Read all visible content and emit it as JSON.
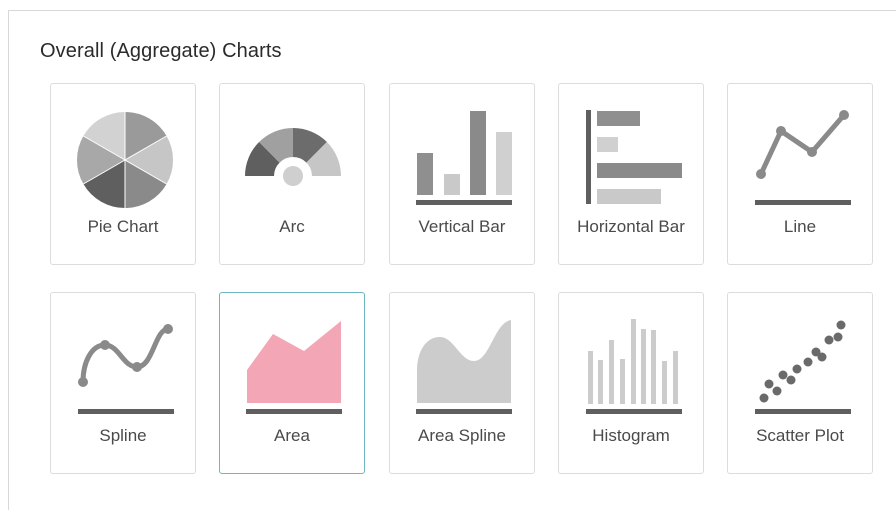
{
  "section": {
    "title": "Overall (Aggregate) Charts"
  },
  "colors": {
    "gray_dark": "#5f5f5f",
    "gray_mid": "#8f8f8f",
    "gray_light": "#c9c9c9",
    "pink": "#f3a6b6",
    "selected_border": "#6fb6c2"
  },
  "tiles": [
    {
      "label": "Pie Chart",
      "icon": "pie-chart-icon"
    },
    {
      "label": "Arc",
      "icon": "arc-chart-icon"
    },
    {
      "label": "Vertical Bar",
      "icon": "vertical-bar-chart-icon"
    },
    {
      "label": "Horizontal Bar",
      "icon": "horizontal-bar-chart-icon"
    },
    {
      "label": "Line",
      "icon": "line-chart-icon"
    },
    {
      "label": "Spline",
      "icon": "spline-chart-icon"
    },
    {
      "label": "Area",
      "icon": "area-chart-icon",
      "selected": true
    },
    {
      "label": "Area Spline",
      "icon": "area-spline-chart-icon"
    },
    {
      "label": "Histogram",
      "icon": "histogram-chart-icon"
    },
    {
      "label": "Scatter Plot",
      "icon": "scatter-plot-icon"
    }
  ]
}
